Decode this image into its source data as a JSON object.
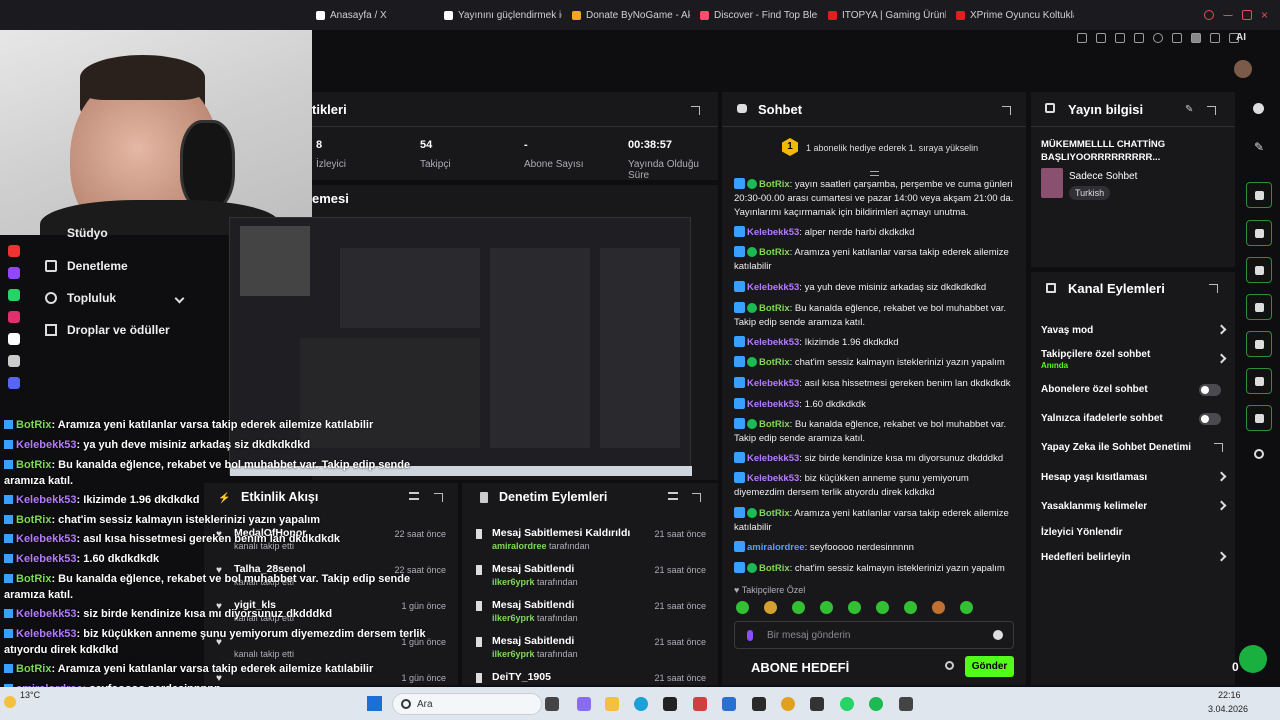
{
  "browser": {
    "tabs": [
      {
        "label": "Anasayfa / X",
        "color": "#ffffff"
      },
      {
        "label": "Yayınını güçlendirmek için",
        "color": "#ffffff"
      },
      {
        "label": "Donate ByNoGame - Akıl",
        "color": "#f5a623"
      },
      {
        "label": "Discover - Find Top Blerps",
        "color": "#ff4d6d"
      },
      {
        "label": "ITOPYA | Gaming Ürünler",
        "color": "#e02020"
      },
      {
        "label": "XPrime Oyuncu Koltukları",
        "color": "#e02020"
      }
    ],
    "ai_label": "AI"
  },
  "sidebar": {
    "items": [
      {
        "label": "Stüdyo"
      },
      {
        "label": "Denetleme"
      },
      {
        "label": "Topluluk"
      },
      {
        "label": "Droplar ve ödüller"
      }
    ]
  },
  "stats": {
    "title_fragment": "tikleri",
    "items": [
      {
        "value": "8",
        "label": "İzleyici"
      },
      {
        "value": "54",
        "label": "Takipçi"
      },
      {
        "value": "-",
        "label": "Abone Sayısı"
      },
      {
        "value": "00:38:57",
        "label": "Yayında Olduğu Süre"
      }
    ]
  },
  "preview": {
    "title_fragment": "emesi"
  },
  "overlay_chat": [
    {
      "user": "BotRix",
      "color": "u1",
      "msg": ": Aramıza yeni katılanlar varsa takip ederek ailemize katılabilir"
    },
    {
      "user": "Kelebekk53",
      "color": "u2",
      "msg": ": ya yuh deve misiniz arkadaş siz dkdkdkdkd"
    },
    {
      "user": "BotRix",
      "color": "u1",
      "msg": ": Bu kanalda eğlence, rekabet ve bol muhabbet var. Takip edip sende"
    },
    {
      "user": "",
      "color": "u1",
      "msg": "aramıza katıl."
    },
    {
      "user": "Kelebekk53",
      "color": "u2",
      "msg": ": Ikizimde 1.96 dkdkdkd"
    },
    {
      "user": "BotRix",
      "color": "u1",
      "msg": ": chat'im sessiz kalmayın isteklerinizi yazın yapalım"
    },
    {
      "user": "Kelebekk53",
      "color": "u2",
      "msg": ": asıl kısa hissetmesi gereken benim lan dkdkdkdk"
    },
    {
      "user": "Kelebekk53",
      "color": "u2",
      "msg": ": 1.60 dkdkdkdk"
    },
    {
      "user": "BotRix",
      "color": "u1",
      "msg": ": Bu kanalda eğlence, rekabet ve bol muhabbet var. Takip edip sende"
    },
    {
      "user": "",
      "color": "u1",
      "msg": "aramıza katıl."
    },
    {
      "user": "Kelebekk53",
      "color": "u2",
      "msg": ": siz birde kendinize kısa mı diyorsunuz dkdddkd"
    },
    {
      "user": "Kelebekk53",
      "color": "u2",
      "msg": ": biz küçükken anneme şunu yemiyorum diyemezdim dersem terlik"
    },
    {
      "user": "",
      "color": "u2",
      "msg": "atıyordu direk kdkdkd"
    },
    {
      "user": "BotRix",
      "color": "u1",
      "msg": ": Aramıza yeni katılanlar varsa takip ederek ailemize katılabilir"
    },
    {
      "user": "amiralordree",
      "color": "u2",
      "msg": ": seyfooooo nerdesinnnnn"
    },
    {
      "user": "BotRix",
      "color": "u1",
      "msg": ": chat'im sessiz kalmayın isteklerinizi yazın yapalım"
    }
  ],
  "activity": {
    "title": "Etkinlik Akışı",
    "rows": [
      {
        "name": "MedalOfHonor",
        "sub": "kanalı takip etti",
        "time": "22 saat önce"
      },
      {
        "name": "Talha_28senol",
        "sub": "kanalı takip etti",
        "time": "22 saat önce"
      },
      {
        "name": "yigit_kls",
        "sub": "kanalı takip etti",
        "time": "1 gün önce"
      },
      {
        "name": "",
        "sub": "kanalı takip etti",
        "time": "1 gün önce"
      },
      {
        "name": "",
        "sub": "",
        "time": "1 gün önce"
      }
    ]
  },
  "mod_actions": {
    "title": "Denetim Eylemleri",
    "rows": [
      {
        "name": "Mesaj Sabitlemesi Kaldırıldı",
        "by": "amiralordree",
        "suffix": "tarafından",
        "time": "21 saat önce"
      },
      {
        "name": "Mesaj Sabitlendi",
        "by": "ilker6yprk",
        "suffix": "tarafından",
        "time": "21 saat önce"
      },
      {
        "name": "Mesaj Sabitlendi",
        "by": "ilker6yprk",
        "suffix": "tarafından",
        "time": "21 saat önce"
      },
      {
        "name": "Mesaj Sabitlendi",
        "by": "ilker6yprk",
        "suffix": "tarafından",
        "time": "21 saat önce"
      },
      {
        "name": "DeiTY_1905",
        "by": "",
        "suffix": "",
        "time": "21 saat önce"
      }
    ]
  },
  "chat": {
    "title": "Sohbet",
    "gift_badge": "1",
    "gift_text": "1 abonelik hediye ederek 1. sıraya yükselin",
    "messages": [
      {
        "user": "BotRix",
        "cls": "n1",
        "bot": true,
        "text": ": yayın saatleri çarşamba, perşembe ve cuma günleri 20:30-00.00 arası cumartesi ve pazar 14:00 veya akşam 21:00 da. Yayınlarımı kaçırmamak için bildirimleri açmayı unutma."
      },
      {
        "user": "Kelebekk53",
        "cls": "n2",
        "bot": false,
        "text": ": alper nerde harbi dkdkdkd"
      },
      {
        "user": "BotRix",
        "cls": "n1",
        "bot": true,
        "text": ": Aramıza yeni katılanlar varsa takip ederek ailemize katılabilir"
      },
      {
        "user": "Kelebekk53",
        "cls": "n2",
        "bot": false,
        "text": ": ya yuh deve misiniz arkadaş siz dkdkdkdkd"
      },
      {
        "user": "BotRix",
        "cls": "n1",
        "bot": true,
        "text": ": Bu kanalda eğlence, rekabet ve bol muhabbet var. Takip edip sende aramıza katıl."
      },
      {
        "user": "Kelebekk53",
        "cls": "n2",
        "bot": false,
        "text": ": Ikizimde 1.96 dkdkdkd"
      },
      {
        "user": "BotRix",
        "cls": "n1",
        "bot": true,
        "text": ": chat'im sessiz kalmayın isteklerinizi yazın yapalım"
      },
      {
        "user": "Kelebekk53",
        "cls": "n2",
        "bot": false,
        "text": ": asıl kısa hissetmesi gereken benim lan dkdkdkdk"
      },
      {
        "user": "Kelebekk53",
        "cls": "n2",
        "bot": false,
        "text": ": 1.60 dkdkdkdk"
      },
      {
        "user": "BotRix",
        "cls": "n1",
        "bot": true,
        "text": ": Bu kanalda eğlence, rekabet ve bol muhabbet var. Takip edip sende aramıza katıl."
      },
      {
        "user": "Kelebekk53",
        "cls": "n2",
        "bot": false,
        "text": ": siz birde kendinize kısa mı diyorsunuz dkdddkd"
      },
      {
        "user": "Kelebekk53",
        "cls": "n2",
        "bot": false,
        "text": ": biz küçükken anneme şunu yemiyorum diyemezdim dersem terlik atıyordu direk kdkdkd"
      },
      {
        "user": "BotRix",
        "cls": "n1",
        "bot": true,
        "text": ": Aramıza yeni katılanlar varsa takip ederek ailemize katılabilir"
      },
      {
        "user": "amiralordree",
        "cls": "n3",
        "bot": false,
        "text": ": seyfooooo nerdesinnnnn"
      },
      {
        "user": "BotRix",
        "cls": "n1",
        "bot": true,
        "text": ": chat'im sessiz kalmayın isteklerinizi yazın yapalım"
      }
    ],
    "followers_only": "Takipçilere Özel",
    "input_placeholder": "Bir mesaj gönderin",
    "send_label": "Gönder",
    "goal_label": "ABONE HEDEFİ"
  },
  "stream_info": {
    "title": "Yayın bilgisi",
    "stream_title": "MÜKEMMELLLL CHATTİNG BAŞLIYOORRRRRRRRR...",
    "category": "Sadece Sohbet",
    "tag": "Turkish"
  },
  "channel_actions": {
    "title": "Kanal Eylemleri",
    "items": [
      {
        "label": "Yavaş mod",
        "type": "chevron",
        "sub": ""
      },
      {
        "label": "Takipçilere özel sohbet",
        "type": "chevron",
        "sub": "Anında"
      },
      {
        "label": "Abonelere özel sohbet",
        "type": "toggle",
        "sub": ""
      },
      {
        "label": "Yalnızca ifadelerle sohbet",
        "type": "toggle",
        "sub": ""
      },
      {
        "label": "Yapay Zeka ile Sohbet Denetimi",
        "type": "external",
        "sub": ""
      },
      {
        "label": "Hesap yaşı kısıtlaması",
        "type": "chevron",
        "sub": ""
      },
      {
        "label": "Yasaklanmış kelimeler",
        "type": "chevron",
        "sub": ""
      },
      {
        "label": "İzleyici Yönlendir",
        "type": "none",
        "sub": ""
      },
      {
        "label": "Hedefleri belirleyin",
        "type": "chevron",
        "sub": ""
      }
    ]
  },
  "taskbar": {
    "weather": "13°C",
    "search": "Ara",
    "time": "22:16",
    "date": "3.04.2026",
    "stream_count": "0"
  },
  "colors": {
    "accent": "#53fc18",
    "bg": "#0e0e10",
    "panel": "#18181b"
  }
}
